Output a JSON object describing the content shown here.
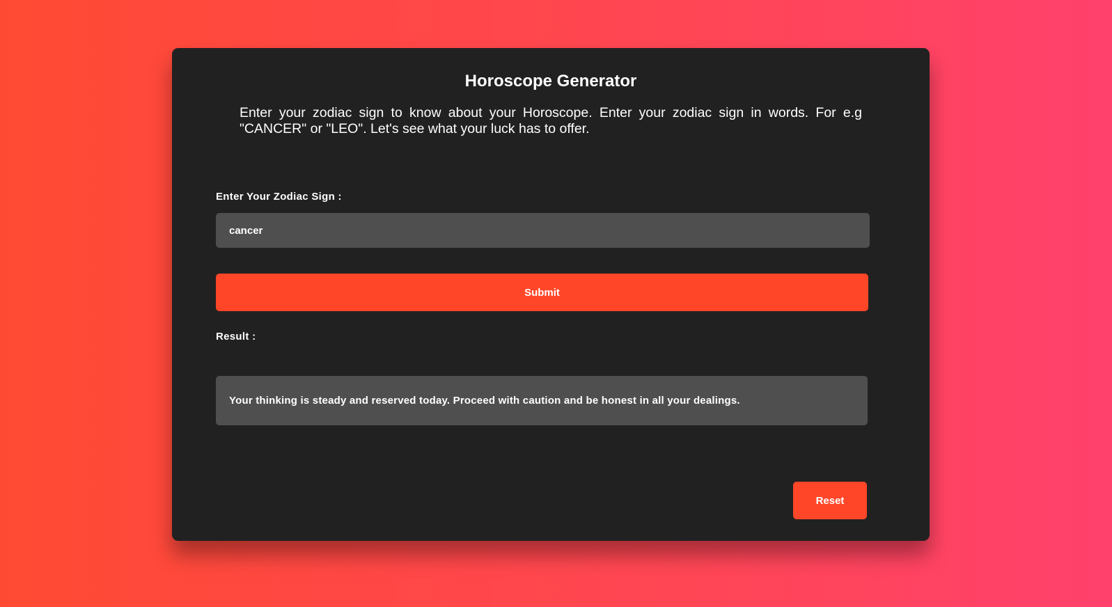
{
  "app": {
    "title": "Horoscope Generator",
    "description": "Enter your zodiac sign to know about your Horoscope. Enter your zodiac sign in words. For e.g \"CANCER\" or \"LEO\". Let's see what your luck has to offer."
  },
  "form": {
    "zodiac_label": "Enter Your Zodiac Sign :",
    "zodiac_value": "cancer",
    "submit_label": "Submit"
  },
  "result": {
    "label": "Result :",
    "text": "Your thinking is steady and reserved today. Proceed with caution and be honest in all your dealings."
  },
  "actions": {
    "reset_label": "Reset"
  },
  "colors": {
    "background_start": "#ff4a33",
    "background_end": "#ff416c",
    "card": "#212121",
    "field": "#4f4f4f",
    "accent": "#ff4628"
  }
}
